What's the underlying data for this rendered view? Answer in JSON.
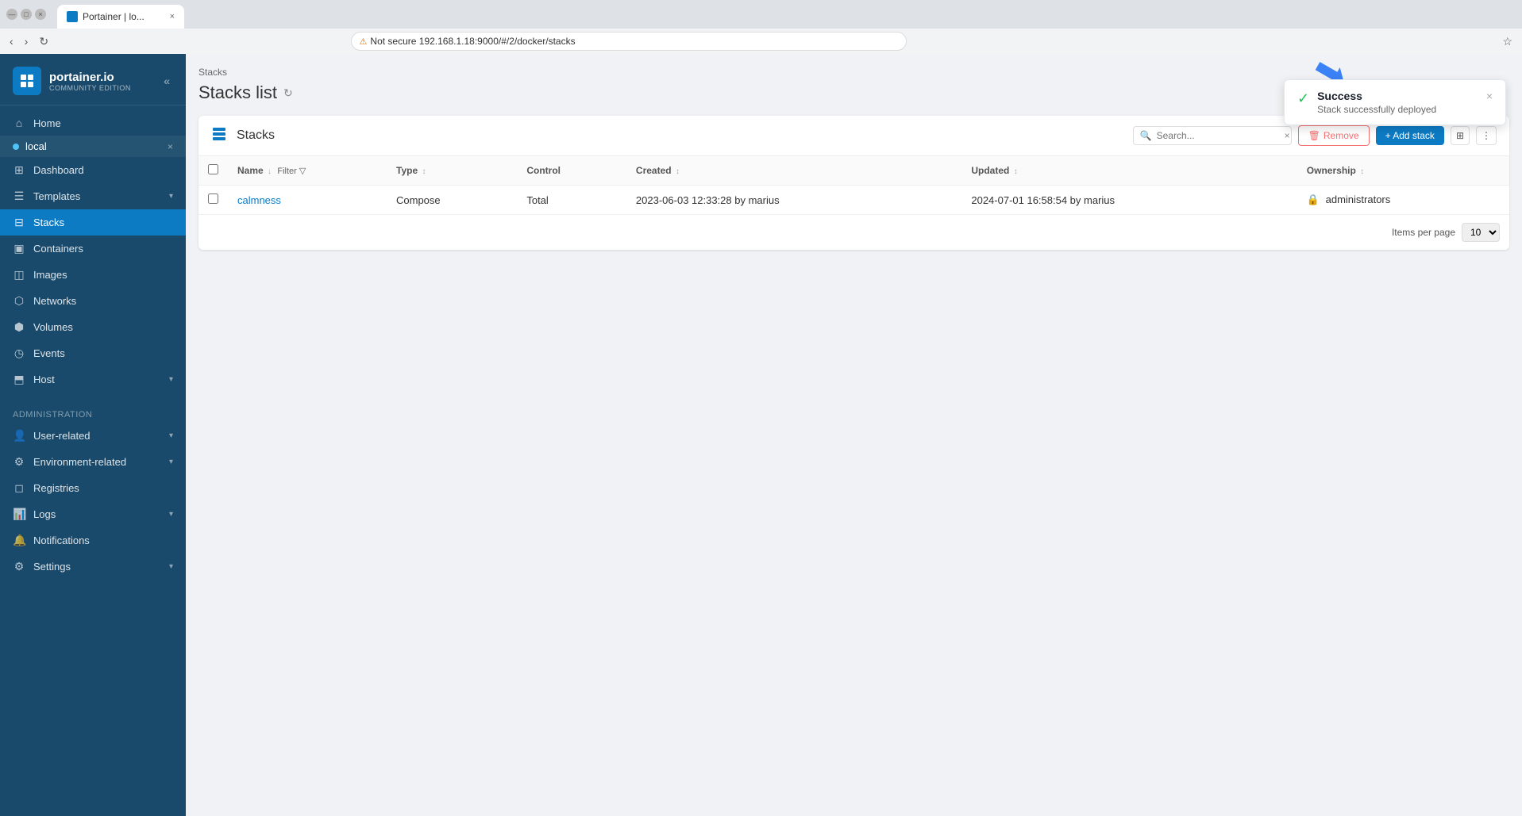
{
  "browser": {
    "tab_title": "Portainer | lo...",
    "url": "192.168.1.18:9000/#/2/docker/stacks",
    "security_label": "Not secure"
  },
  "sidebar": {
    "brand_name": "portainer.io",
    "brand_sub": "COMMUNITY EDITION",
    "collapse_label": "«",
    "env_name": "local",
    "items": [
      {
        "id": "home",
        "label": "Home",
        "icon": "⌂"
      },
      {
        "id": "dashboard",
        "label": "Dashboard",
        "icon": "⊞"
      },
      {
        "id": "templates",
        "label": "Templates",
        "icon": "☰",
        "has_chevron": true
      },
      {
        "id": "stacks",
        "label": "Stacks",
        "icon": "⊟",
        "active": true
      },
      {
        "id": "containers",
        "label": "Containers",
        "icon": "▣"
      },
      {
        "id": "images",
        "label": "Images",
        "icon": "◫"
      },
      {
        "id": "networks",
        "label": "Networks",
        "icon": "⬡"
      },
      {
        "id": "volumes",
        "label": "Volumes",
        "icon": "⬢"
      },
      {
        "id": "events",
        "label": "Events",
        "icon": "◷"
      },
      {
        "id": "host",
        "label": "Host",
        "icon": "⬒",
        "has_chevron": true
      }
    ],
    "admin_header": "Administration",
    "admin_items": [
      {
        "id": "user-related",
        "label": "User-related",
        "icon": "👤",
        "has_chevron": true
      },
      {
        "id": "environment-related",
        "label": "Environment-related",
        "icon": "⚙",
        "has_chevron": true
      },
      {
        "id": "registries",
        "label": "Registries",
        "icon": "◻"
      },
      {
        "id": "logs",
        "label": "Logs",
        "icon": "📊",
        "has_chevron": true
      },
      {
        "id": "notifications",
        "label": "Notifications",
        "icon": "🔔"
      },
      {
        "id": "settings",
        "label": "Settings",
        "icon": "⚙",
        "has_chevron": true
      }
    ]
  },
  "breadcrumb": "Stacks",
  "page_title": "Stacks list",
  "panel": {
    "title": "Stacks",
    "search_placeholder": "Search...",
    "remove_label": "Remove",
    "add_label": "+ Add stack",
    "columns": {
      "name": "Name",
      "type": "Type",
      "control": "Control",
      "created": "Created",
      "updated": "Updated",
      "ownership": "Ownership"
    },
    "rows": [
      {
        "name": "calmness",
        "type": "Compose",
        "control": "Total",
        "created": "2023-06-03 12:33:28 by marius",
        "updated": "2024-07-01 16:58:54 by marius",
        "ownership": "administrators"
      }
    ],
    "footer": {
      "items_per_page_label": "Items per page",
      "items_per_page_value": "10"
    }
  },
  "notification": {
    "title": "Success",
    "message": "Stack successfully deployed",
    "close_label": "×"
  }
}
